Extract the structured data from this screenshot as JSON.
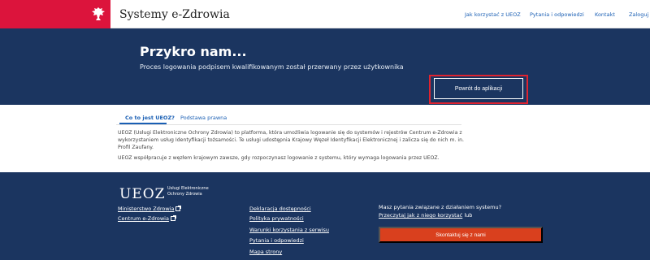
{
  "header": {
    "site_title": "Systemy e-Zdrowia",
    "nav": [
      "Jak korzystać z UEOZ",
      "Pytania i odpowiedzi",
      "Kontakt",
      "Zaloguj si"
    ]
  },
  "hero": {
    "title": "Przykro nam...",
    "subtitle": "Proces logowania podpisem kwalifikowanym został przerwany przez użytkownika",
    "button": "Powrót do aplikacji"
  },
  "info": {
    "tabs": [
      "Co to jest UEOZ?",
      "Podstawa prawna"
    ],
    "paragraph1_line1": "UEOZ (Usługi Elektroniczne Ochrony Zdrowia) to platforma, która umożliwia logowanie się do systemów i rejestrów Centrum e-Zdrowia z",
    "paragraph1_line2": "wykorzystaniem usług Identyfikacji tożsamości. Te usługi udostępnia Krajowy Węzeł Identyfikacji Elektronicznej i zalicza się do nich m. in.",
    "paragraph1_line3": "Profil Zaufany.",
    "paragraph2": "UEOZ współpracuje z węzłem krajowym zawsze, gdy rozpoczynasz logowanie z systemu, który wymaga logowania przez UEOZ."
  },
  "footer": {
    "logo": "UEOZ",
    "logo_sub_line1": "Usługi Elektroniczne",
    "logo_sub_line2": "Ochrony Zdrowia",
    "links_col1": [
      "Ministerstwo Zdrowia",
      "Centrum e-Zdrowia"
    ],
    "links_col2": [
      "Deklaracja dostępności",
      "Polityka prywatności",
      "Warunki korzystania z serwisu",
      "Pytania i odpowiedzi",
      "Mapa strony"
    ],
    "question": "Masz pytania związane z działaniem systemu?",
    "read_link": "Przeczytaj jak z niego korzystać",
    "read_suffix": " lub",
    "contact_button": "Skontaktuj się z nami"
  },
  "colors": {
    "navy": "#1b3560",
    "flag_red": "#dc143c",
    "highlight_red": "#e0232f",
    "contact_orange": "#d9401e",
    "link_blue": "#1a5fb4"
  }
}
